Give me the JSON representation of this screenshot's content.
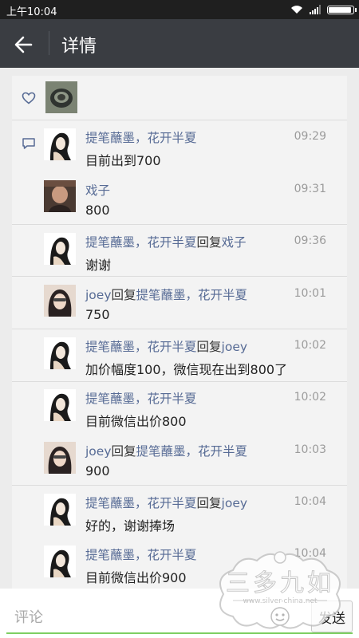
{
  "status": {
    "time": "上午10:04"
  },
  "header": {
    "title": "详情"
  },
  "comments": [
    {
      "name": "提笔蘸墨，花开半夏",
      "reply": "",
      "reply_to": "",
      "time": "09:29",
      "text": "目前出到700"
    },
    {
      "name": "戏子",
      "reply": "",
      "reply_to": "",
      "time": "09:31",
      "text": "800"
    },
    {
      "name": "提笔蘸墨，花开半夏",
      "reply": "回复",
      "reply_to": "戏子",
      "time": "09:36",
      "text": "谢谢"
    },
    {
      "name": "joey",
      "reply": "回复",
      "reply_to": "提笔蘸墨，花开半夏",
      "time": "10:01",
      "text": "750"
    },
    {
      "name": "提笔蘸墨，花开半夏",
      "reply": "回复",
      "reply_to": "joey",
      "time": "10:02",
      "text": "加价幅度100，微信现在出到800了"
    },
    {
      "name": "提笔蘸墨，花开半夏",
      "reply": "",
      "reply_to": "",
      "time": "10:02",
      "text": "目前微信出价800"
    },
    {
      "name": "joey",
      "reply": "回复",
      "reply_to": "提笔蘸墨，花开半夏",
      "time": "10:03",
      "text": "900"
    },
    {
      "name": "提笔蘸墨，花开半夏",
      "reply": "回复",
      "reply_to": "joey",
      "time": "10:04",
      "text": "好的，谢谢捧场"
    },
    {
      "name": "提笔蘸墨，花开半夏",
      "reply": "",
      "reply_to": "",
      "time": "10:04",
      "text": "目前微信出价900"
    }
  ],
  "input": {
    "placeholder": "评论",
    "send_label": "发送"
  },
  "watermark": {
    "text": "三多九如",
    "url": "www.silver-china.net"
  }
}
